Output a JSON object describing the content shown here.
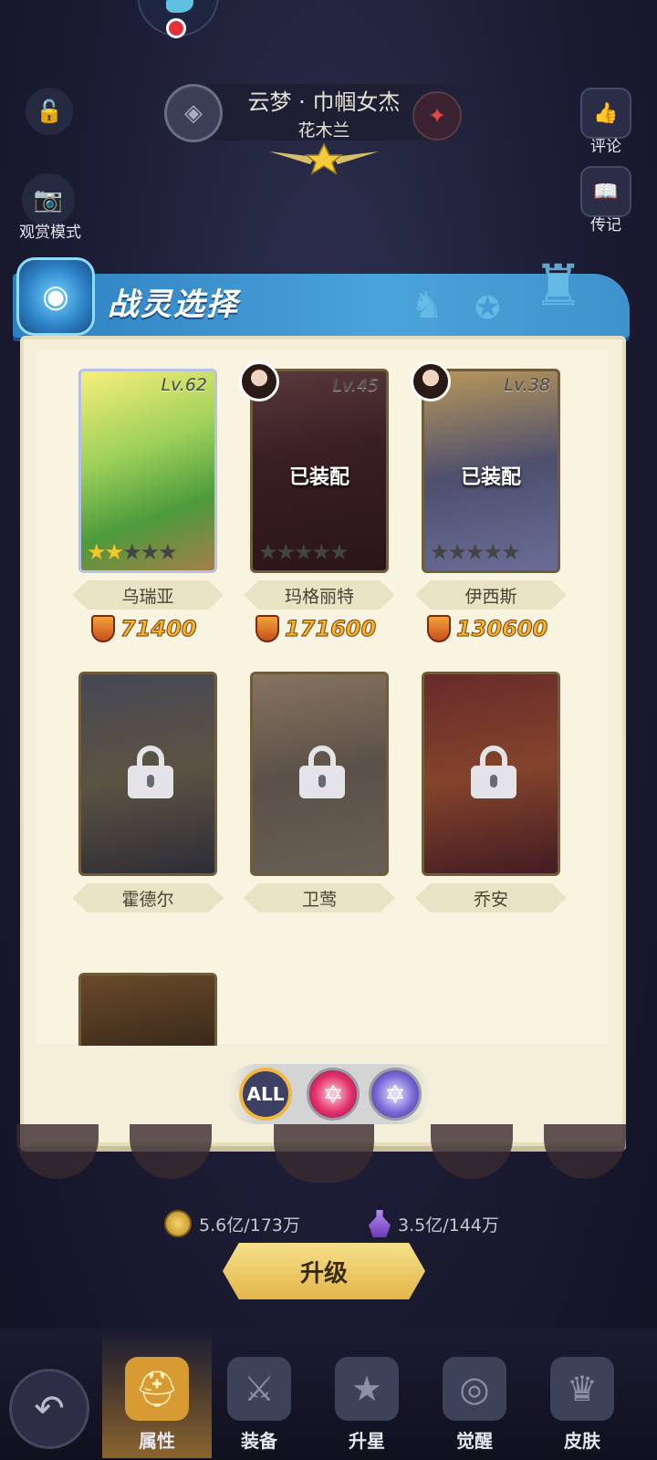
{
  "hero": {
    "title": "云梦 · 巾帼女杰",
    "subtitle": "花木兰"
  },
  "left_buttons": {
    "view_mode_label": "观赏模式"
  },
  "right_buttons": [
    {
      "label": "评论",
      "icon": "thumbs-up-icon"
    },
    {
      "label": "传记",
      "icon": "book-icon"
    }
  ],
  "modal": {
    "title": "战灵选择",
    "spirits": [
      {
        "name": "乌瑞亚",
        "level": "Lv.62",
        "power": "71400",
        "equipped": "",
        "stars_on": 2,
        "stars_total": 5,
        "locked": false
      },
      {
        "name": "玛格丽特",
        "level": "Lv.45",
        "power": "171600",
        "equipped": "已装配",
        "stars_on": 0,
        "stars_total": 5,
        "locked": false
      },
      {
        "name": "伊西斯",
        "level": "Lv.38",
        "power": "130600",
        "equipped": "已装配",
        "stars_on": 0,
        "stars_total": 5,
        "locked": false
      },
      {
        "name": "霍德尔",
        "locked": true
      },
      {
        "name": "卫莺",
        "locked": true
      },
      {
        "name": "乔安",
        "locked": true
      }
    ],
    "filters": {
      "all_label": "ALL",
      "selected": "ALL"
    }
  },
  "resources": {
    "gold": "5.6亿/173万",
    "potion": "3.5亿/144万"
  },
  "upgrade_label": "升级",
  "nav_tabs": [
    {
      "label": "属性",
      "active": true,
      "icon": "helmet-icon"
    },
    {
      "label": "装备",
      "active": false,
      "icon": "swords-icon"
    },
    {
      "label": "升星",
      "active": false,
      "icon": "star-badge-icon"
    },
    {
      "label": "觉醒",
      "active": false,
      "icon": "spiral-icon"
    },
    {
      "label": "皮肤",
      "active": false,
      "icon": "armor-icon"
    }
  ],
  "colors": {
    "banner": "#4aa3d9",
    "panel": "#f3efd8",
    "power": "#f2b52a",
    "active_tab": "#d89a32"
  }
}
